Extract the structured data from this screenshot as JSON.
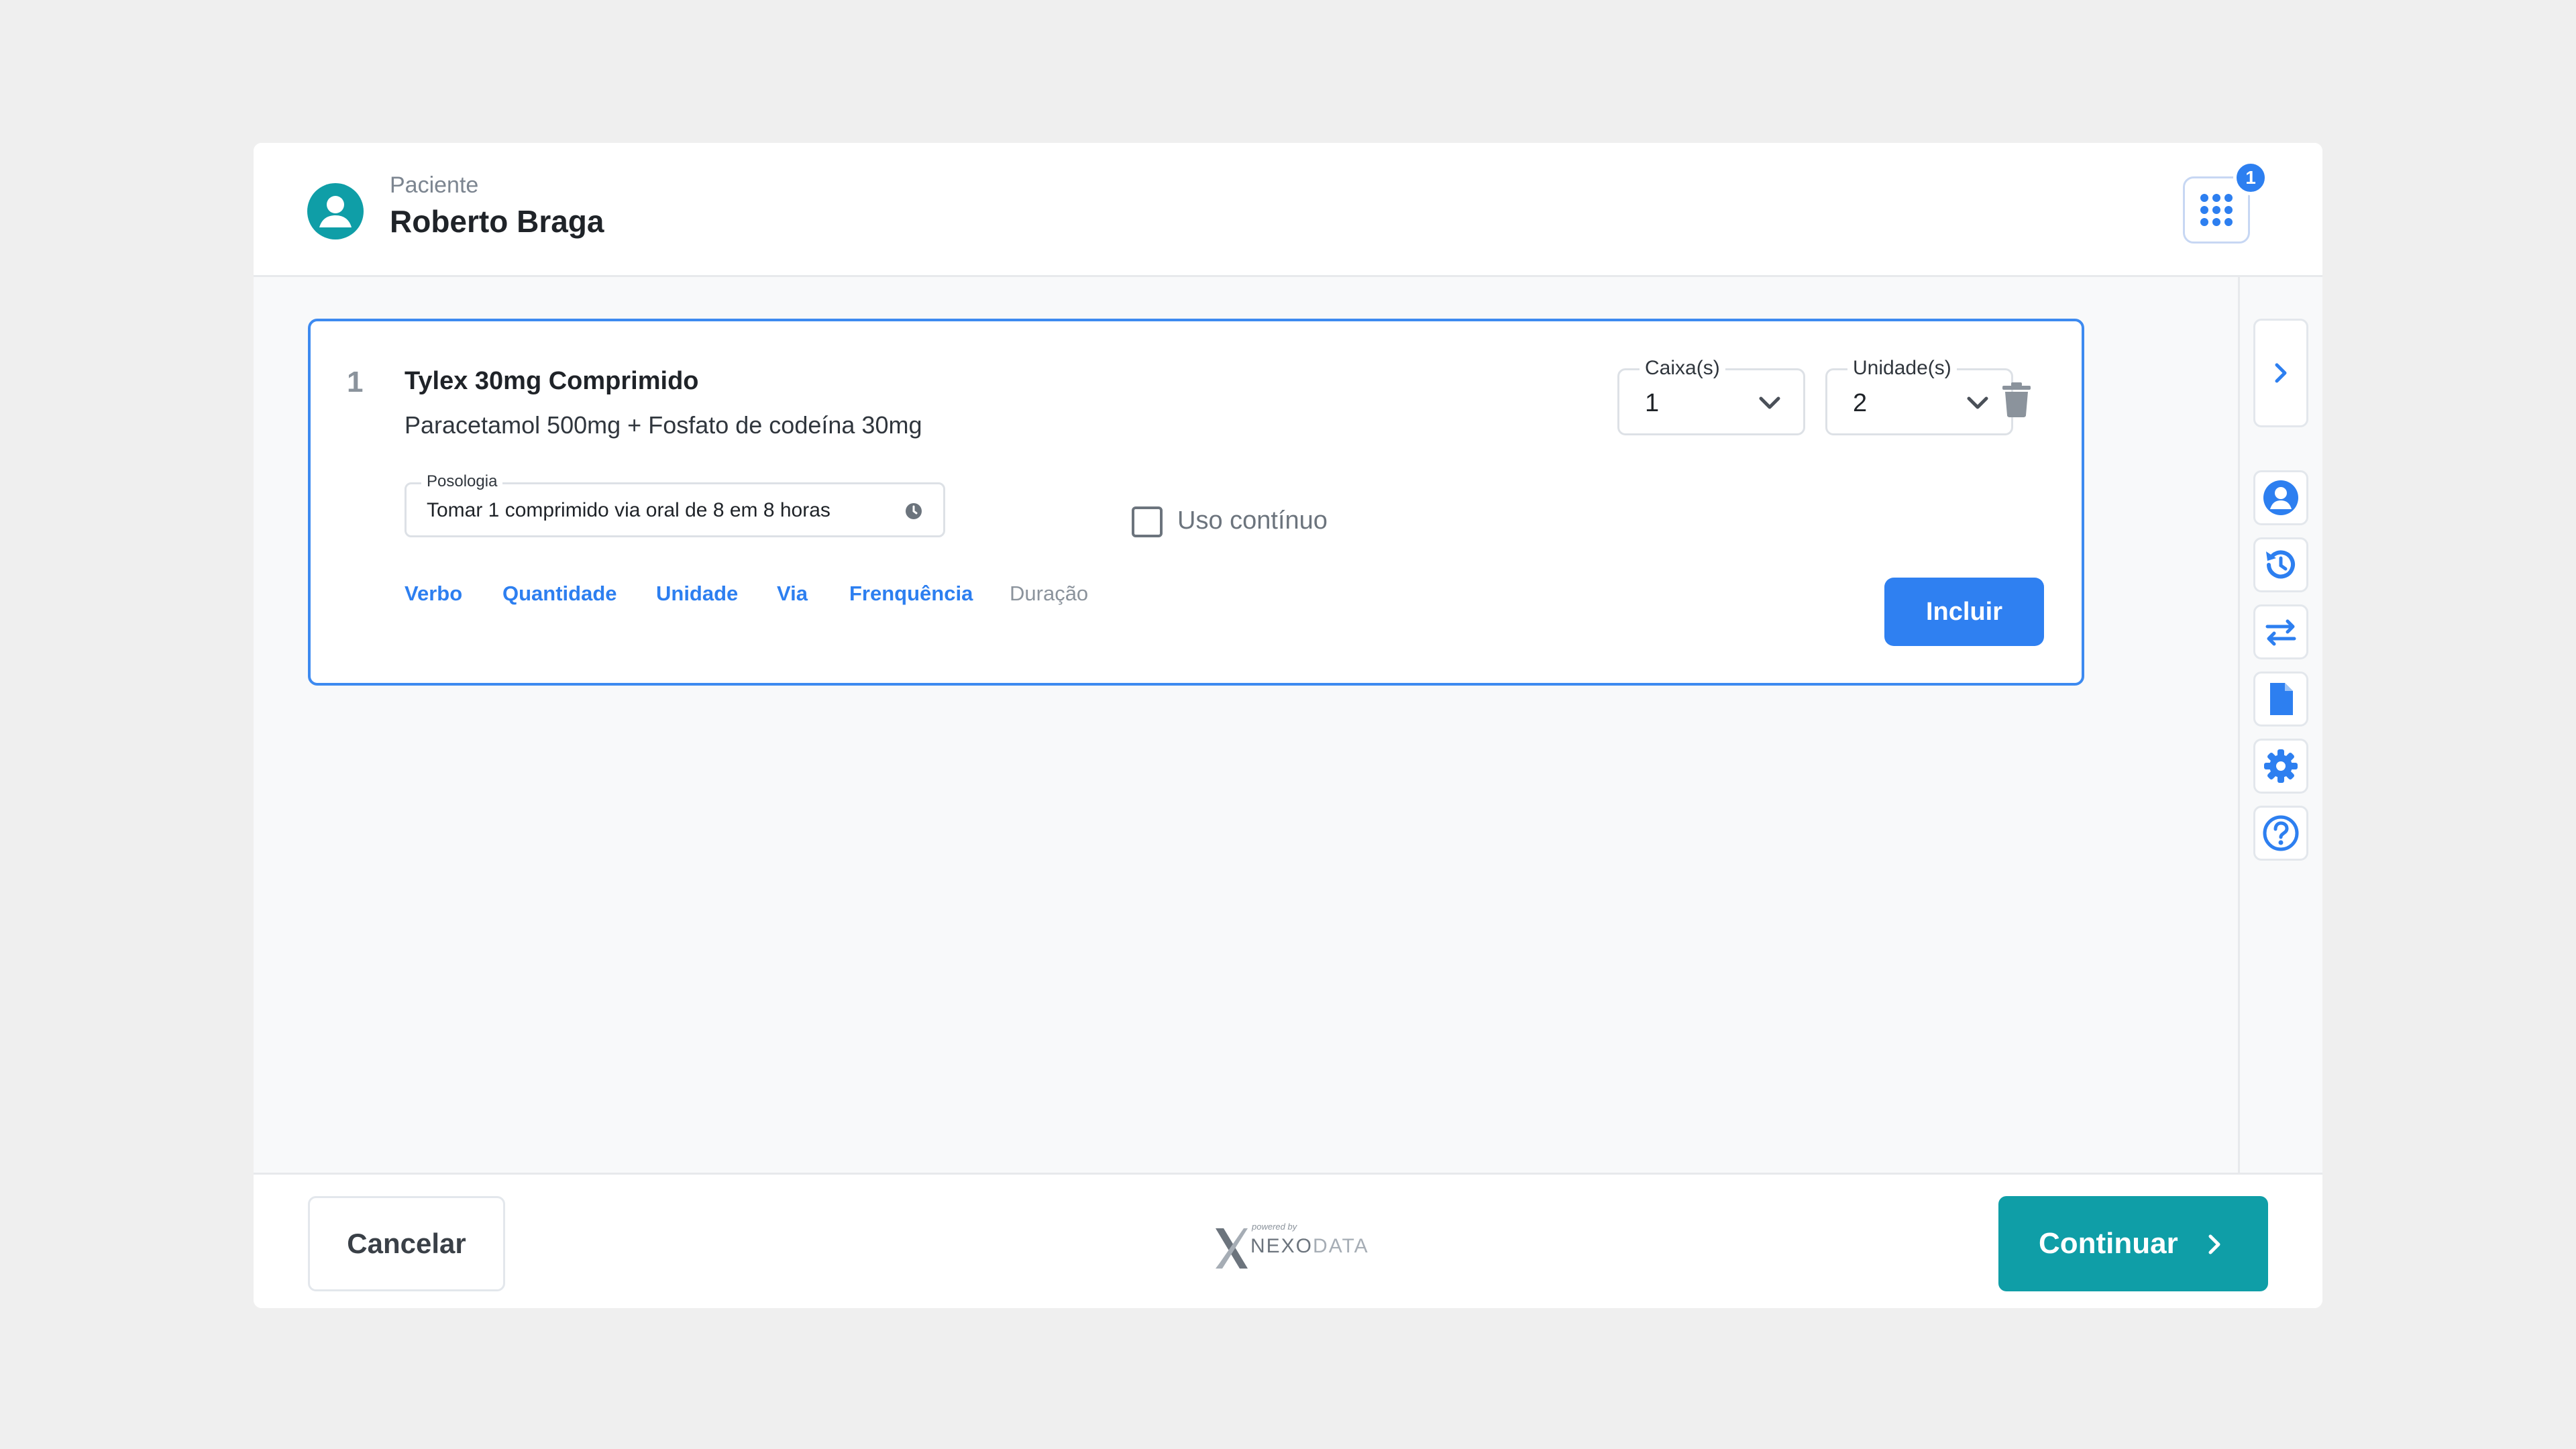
{
  "header": {
    "patient_label": "Paciente",
    "patient_name": "Roberto Braga",
    "apps_badge_count": "1"
  },
  "medication": {
    "index": "1",
    "name": "Tylex 30mg Comprimido",
    "composition": "Paracetamol 500mg + Fosfato de codeína 30mg",
    "boxes": {
      "label": "Caixa(s)",
      "value": "1"
    },
    "units": {
      "label": "Unidade(s)",
      "value": "2"
    },
    "posologia": {
      "label": "Posologia",
      "value": "Tomar 1 comprimido via oral de 8 em 8 horas"
    },
    "continuous_use": {
      "label": "Uso contínuo",
      "checked": false
    },
    "chips": [
      {
        "label": "Verbo",
        "active": true
      },
      {
        "label": "Quantidade",
        "active": true
      },
      {
        "label": "Unidade",
        "active": true
      },
      {
        "label": "Via",
        "active": true
      },
      {
        "label": "Frenquência",
        "active": true
      },
      {
        "label": "Duração",
        "active": false
      }
    ],
    "include_label": "Incluir"
  },
  "footer": {
    "cancel_label": "Cancelar",
    "continue_label": "Continuar",
    "logo": {
      "powered_by": "powered by",
      "brand_bold": "NEXO",
      "brand_light": "DATA"
    }
  },
  "sidebar_icons": [
    "chevron-right-icon",
    "user-icon",
    "history-icon",
    "swap-icon",
    "document-icon",
    "gear-icon",
    "help-icon"
  ],
  "colors": {
    "primary": "#2f80f1",
    "teal": "#0f9ea7",
    "card_border": "#3d8af0"
  }
}
